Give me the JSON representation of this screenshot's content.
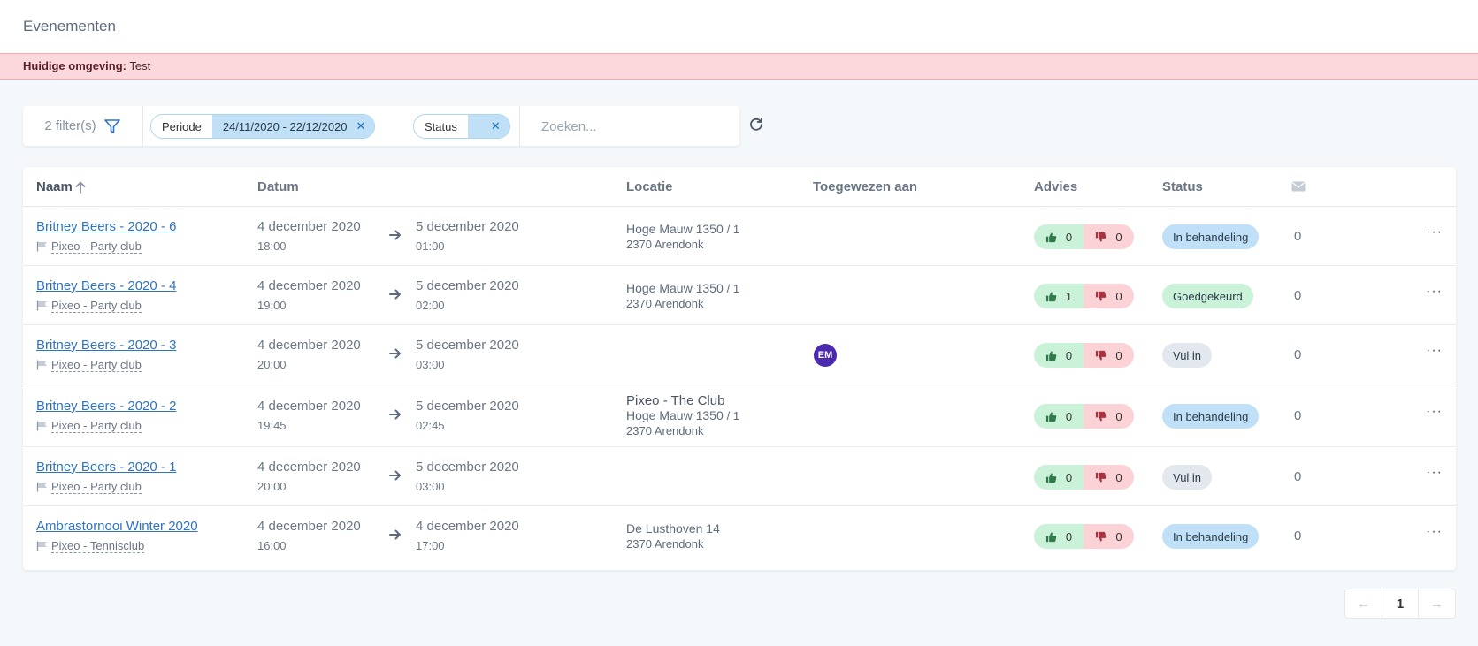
{
  "header": {
    "title": "Evenementen"
  },
  "environment": {
    "label": "Huidige omgeving:",
    "value": "Test"
  },
  "filters": {
    "count_label": "2 filter(s)",
    "chips": [
      {
        "key": "Periode",
        "value": "24/11/2020 - 22/12/2020"
      },
      {
        "key": "Status",
        "value": ""
      }
    ],
    "search_placeholder": "Zoeken..."
  },
  "table": {
    "columns": {
      "name": "Naam",
      "date": "Datum",
      "location": "Locatie",
      "assigned": "Toegewezen aan",
      "advice": "Advies",
      "status": "Status"
    },
    "rows": [
      {
        "event": "Britney Beers - 2020 - 6",
        "org": "Pixeo - Party club",
        "start_date": "4 december 2020",
        "start_time": "18:00",
        "end_date": "5 december 2020",
        "end_time": "01:00",
        "loc_name": "",
        "loc_street": "Hoge Mauw 1350",
        "loc_nr": "/ 1",
        "loc_city": "2370 Arendonk",
        "assigned": "",
        "up": "0",
        "down": "0",
        "status": "In behandeling",
        "mails": "0"
      },
      {
        "event": "Britney Beers - 2020 - 4",
        "org": "Pixeo - Party club",
        "start_date": "4 december 2020",
        "start_time": "19:00",
        "end_date": "5 december 2020",
        "end_time": "02:00",
        "loc_name": "",
        "loc_street": "Hoge Mauw 1350",
        "loc_nr": "/ 1",
        "loc_city": "2370 Arendonk",
        "assigned": "",
        "up": "1",
        "down": "0",
        "status": "Goedgekeurd",
        "mails": "0"
      },
      {
        "event": "Britney Beers - 2020 - 3",
        "org": "Pixeo - Party club",
        "start_date": "4 december 2020",
        "start_time": "20:00",
        "end_date": "5 december 2020",
        "end_time": "03:00",
        "loc_name": "",
        "loc_street": "",
        "loc_nr": "",
        "loc_city": "",
        "assigned": "EM",
        "up": "0",
        "down": "0",
        "status": "Vul in",
        "mails": "0"
      },
      {
        "event": "Britney Beers - 2020 - 2",
        "org": "Pixeo - Party club",
        "start_date": "4 december 2020",
        "start_time": "19:45",
        "end_date": "5 december 2020",
        "end_time": "02:45",
        "loc_name": "Pixeo - The Club",
        "loc_street": "Hoge Mauw 1350",
        "loc_nr": "/ 1",
        "loc_city": "2370 Arendonk",
        "assigned": "",
        "up": "0",
        "down": "0",
        "status": "In behandeling",
        "mails": "0"
      },
      {
        "event": "Britney Beers - 2020 - 1",
        "org": "Pixeo - Party club",
        "start_date": "4 december 2020",
        "start_time": "20:00",
        "end_date": "5 december 2020",
        "end_time": "03:00",
        "loc_name": "",
        "loc_street": "",
        "loc_nr": "",
        "loc_city": "",
        "assigned": "",
        "up": "0",
        "down": "0",
        "status": "Vul in",
        "mails": "0"
      },
      {
        "event": "Ambrastornooi Winter 2020",
        "org": "Pixeo - Tennisclub",
        "start_date": "4 december 2020",
        "start_time": "16:00",
        "end_date": "4 december 2020",
        "end_time": "17:00",
        "loc_name": "",
        "loc_street": "De Lusthoven 14",
        "loc_nr": "",
        "loc_city": "2370 Arendonk",
        "assigned": "",
        "up": "0",
        "down": "0",
        "status": "In behandeling",
        "mails": "0"
      }
    ]
  },
  "pagination": {
    "current": "1",
    "prev_icon": "arrow-left-icon",
    "next_icon": "arrow-right-icon"
  },
  "colors": {
    "accent": "#2f73c4",
    "env_bg": "#fbd8dc",
    "status_blue": "#bfe0f7",
    "status_green": "#c9f2d8",
    "status_grey": "#e3e8ee",
    "avatar": "#4c2ab0"
  }
}
